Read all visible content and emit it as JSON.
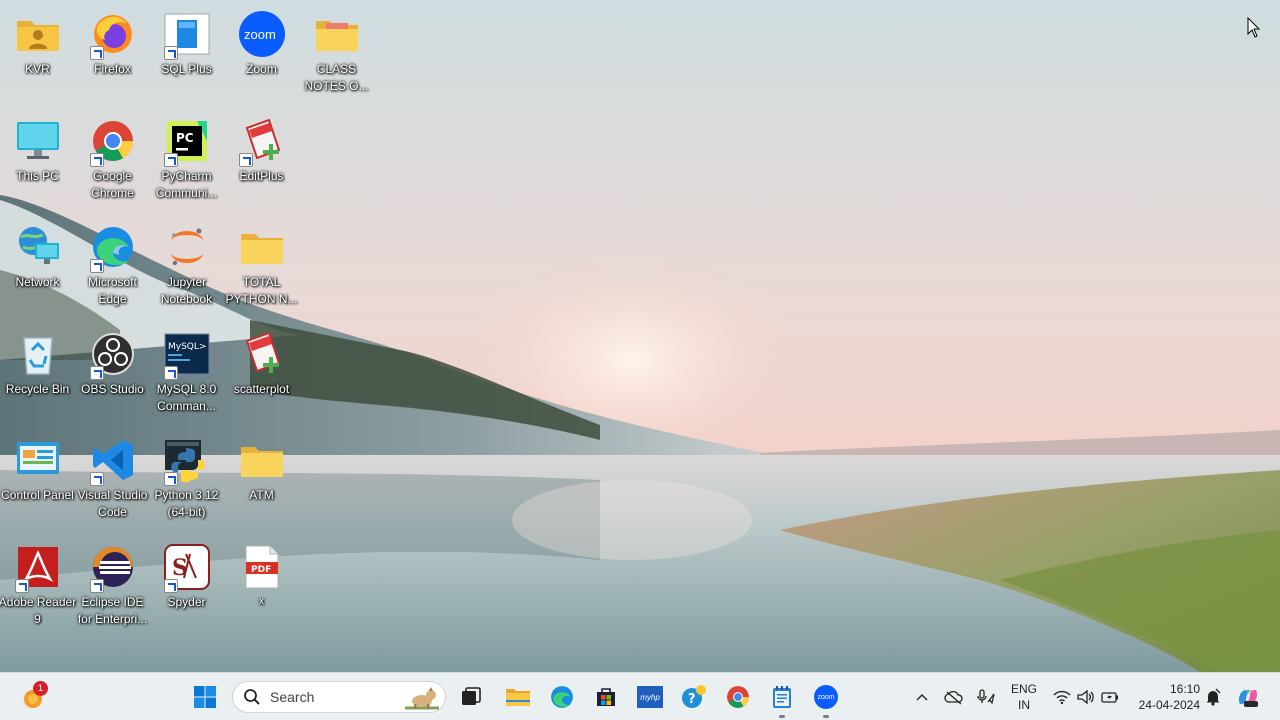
{
  "desktop": {
    "icons": [
      {
        "label": "KVR",
        "icon": "user-folder-icon"
      },
      {
        "label": "Firefox",
        "icon": "firefox-icon"
      },
      {
        "label": "SQL Plus",
        "icon": "sqlplus-icon"
      },
      {
        "label": "Zoom",
        "icon": "zoom-icon"
      },
      {
        "label": "CLASS NOTES O...",
        "icon": "folder-icon"
      },
      {
        "label": "This PC",
        "icon": "monitor-icon"
      },
      {
        "label": "Google Chrome",
        "icon": "chrome-icon"
      },
      {
        "label": "PyCharm Communi...",
        "icon": "pycharm-icon"
      },
      {
        "label": "EditPlus",
        "icon": "editplus-icon"
      },
      {
        "label": "Network",
        "icon": "network-icon"
      },
      {
        "label": "Microsoft Edge",
        "icon": "edge-icon"
      },
      {
        "label": "Jupyter Notebook",
        "icon": "jupyter-icon"
      },
      {
        "label": "TOTAL PYTHON N...",
        "icon": "folder-icon"
      },
      {
        "label": "Recycle Bin",
        "icon": "recycle-bin-icon"
      },
      {
        "label": "OBS Studio",
        "icon": "obs-icon"
      },
      {
        "label": "MySQL 8.0 Comman...",
        "icon": "mysql-icon"
      },
      {
        "label": "scatterplot",
        "icon": "editplus-icon"
      },
      {
        "label": "Control Panel",
        "icon": "control-panel-icon"
      },
      {
        "label": "Visual Studio Code",
        "icon": "vscode-icon"
      },
      {
        "label": "Python 3.12 (64-bit)",
        "icon": "python-icon"
      },
      {
        "label": "ATM",
        "icon": "folder-icon"
      },
      {
        "label": "Adobe Reader 9",
        "icon": "adobe-reader-icon"
      },
      {
        "label": "Eclipse IDE for Enterpri...",
        "icon": "eclipse-icon"
      },
      {
        "label": "Spyder",
        "icon": "spyder-icon"
      },
      {
        "label": "x",
        "icon": "pdf-file-icon"
      }
    ]
  },
  "taskbar": {
    "widget_badge": "1",
    "search_placeholder": "Search",
    "apps": [
      {
        "name": "start-button",
        "icon": "windows-icon"
      },
      {
        "name": "file-explorer-app",
        "icon": "folder-icon"
      },
      {
        "name": "task-view",
        "icon": "task-view-icon"
      },
      {
        "name": "edge-app",
        "icon": "edge-icon"
      },
      {
        "name": "store-app",
        "icon": "store-icon"
      },
      {
        "name": "myhp-app",
        "icon": "myhp-icon"
      },
      {
        "name": "help-app",
        "icon": "help-icon"
      },
      {
        "name": "chrome-app",
        "icon": "chrome-icon"
      },
      {
        "name": "notepad-app",
        "icon": "notepad-icon"
      },
      {
        "name": "zoom-app",
        "icon": "zoom-icon"
      }
    ],
    "myhp_label": "myhp",
    "zoom_label": "zoom",
    "tray": {
      "lang_top": "ENG",
      "lang_bottom": "IN",
      "time": "16:10",
      "date": "24-04-2024"
    }
  },
  "colors": {
    "taskbar_bg": "#ebf0f2",
    "windows_blue": "#0a78d4",
    "folder_yellow": "#f6c543"
  }
}
